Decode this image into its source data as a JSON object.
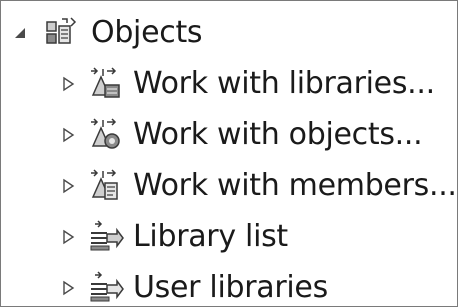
{
  "tree": {
    "root": {
      "label": "Objects",
      "icon": "objects-icon",
      "expanded": true
    },
    "children": [
      {
        "label": "Work with libraries...",
        "icon": "work-with-libraries-icon",
        "expanded": false
      },
      {
        "label": "Work with objects...",
        "icon": "work-with-objects-icon",
        "expanded": false
      },
      {
        "label": "Work with members...",
        "icon": "work-with-members-icon",
        "expanded": false
      },
      {
        "label": "Library list",
        "icon": "library-list-icon",
        "expanded": false
      },
      {
        "label": "User libraries",
        "icon": "user-libraries-icon",
        "expanded": false
      }
    ]
  },
  "colors": {
    "text": "#1a1a1a",
    "border": "#7a7a7a",
    "icon_dark": "#3a3a3a",
    "icon_mid": "#8a8a8a",
    "icon_light": "#cfcfcf",
    "twisty": "#4a4a4a"
  }
}
